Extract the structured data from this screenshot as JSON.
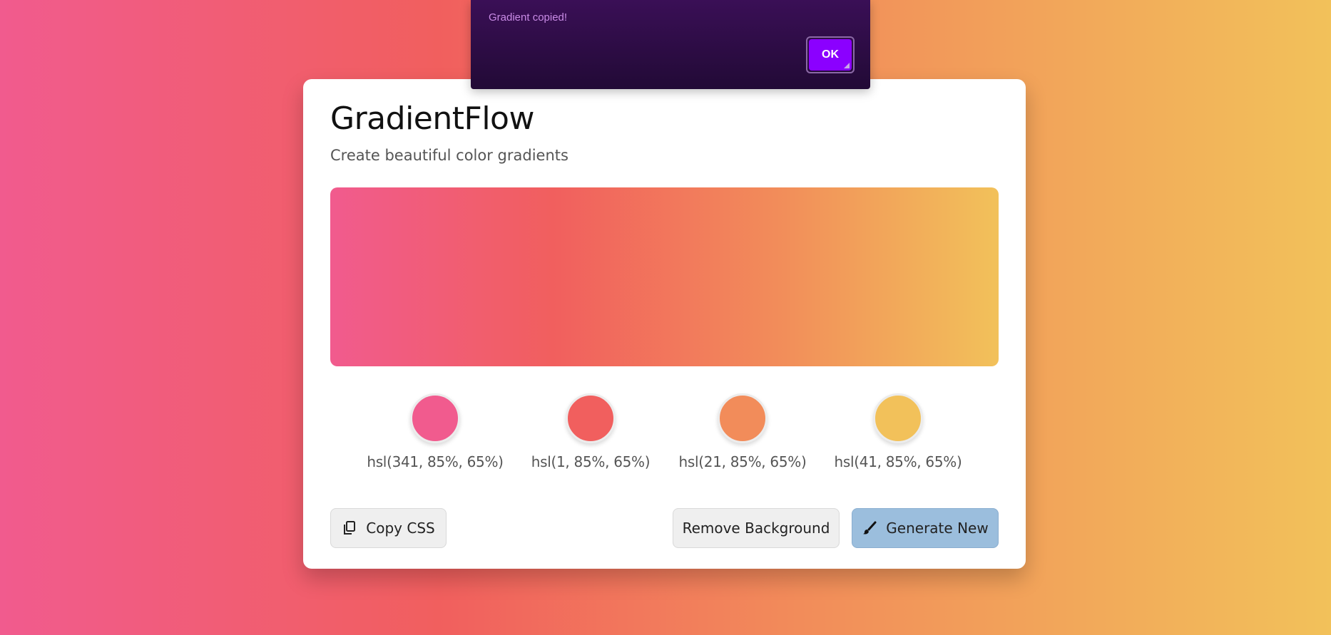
{
  "toast": {
    "message": "Gradient copied!",
    "ok_label": "OK"
  },
  "app": {
    "title": "GradientFlow",
    "subtitle": "Create beautiful color gradients"
  },
  "gradient": {
    "stops": [
      "#f15b8e",
      "#f15f5e",
      "#f28c5a",
      "#f2c15a"
    ]
  },
  "swatches": [
    {
      "label": "hsl(341, 85%, 65%)",
      "color": "#f15b8e"
    },
    {
      "label": "hsl(1, 85%, 65%)",
      "color": "#f15f5e"
    },
    {
      "label": "hsl(21, 85%, 65%)",
      "color": "#f28c5a"
    },
    {
      "label": "hsl(41, 85%, 65%)",
      "color": "#f2c15a"
    }
  ],
  "actions": {
    "copy_label": "Copy CSS",
    "copy_icon": "copy-icon",
    "remove_label": "Remove Background",
    "generate_label": "Generate New",
    "generate_icon": "brush-icon"
  }
}
